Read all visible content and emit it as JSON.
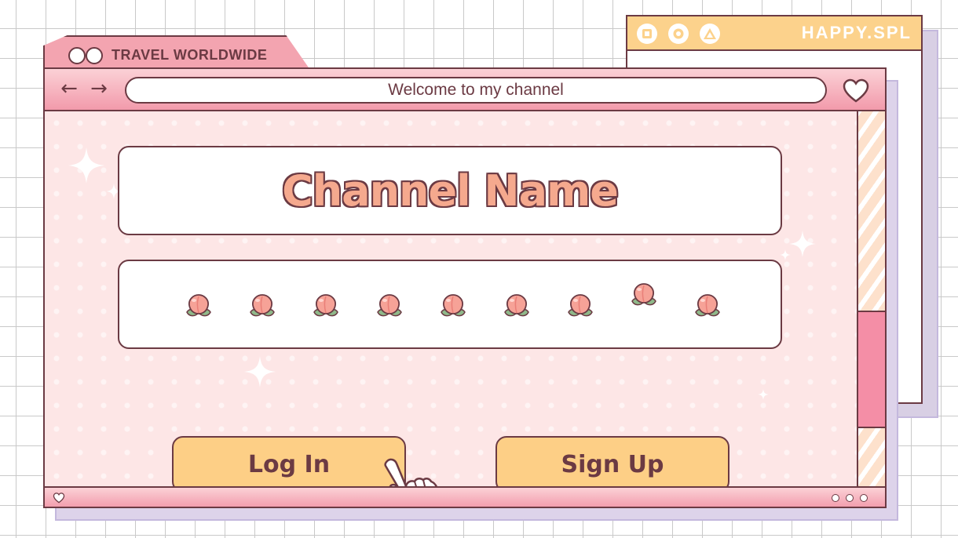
{
  "back_window": {
    "title": "HAPPY.SPL",
    "controls": [
      "square-icon",
      "circle-icon",
      "triangle-icon"
    ],
    "bar_color": "#fcd28c"
  },
  "main_window": {
    "tab_title": "TRAVEL WORLDWIDE",
    "url_bar_text": "Welcome to my channel",
    "nav": {
      "back_icon": "left-arrow-icon",
      "forward_icon": "right-arrow-icon",
      "favorite_icon": "heart-icon"
    },
    "accent_color": "#f29aab"
  },
  "content": {
    "channel_name": "Channel Name",
    "peach_icon": "peach-icon",
    "peach_count": 9,
    "login_label": "Log In",
    "signup_label": "Sign Up",
    "button_color": "#fdcf86",
    "cursor_icon": "hand-pointer-icon"
  }
}
